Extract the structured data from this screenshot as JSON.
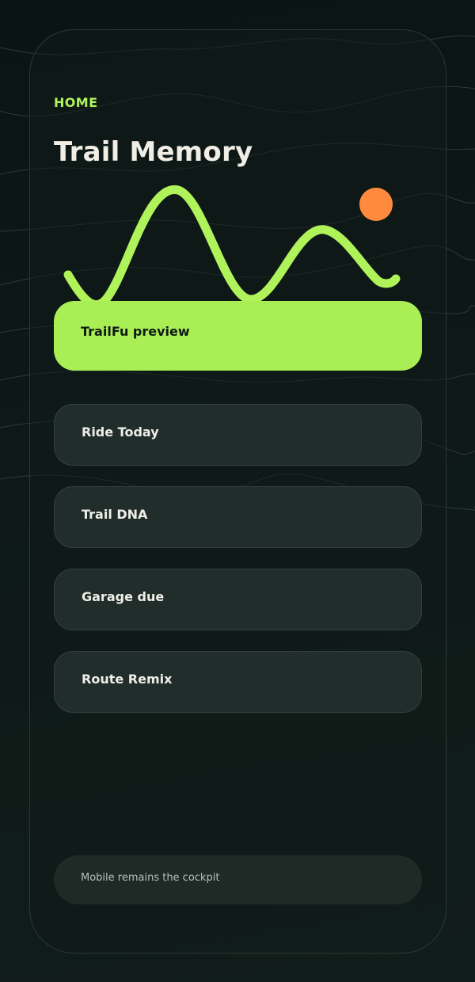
{
  "header": {
    "eyebrow": "HOME",
    "title": "Trail Memory"
  },
  "hero": {
    "trail_icon": "trail-wave-icon",
    "sun_icon": "sun-icon",
    "trail_color": "#b0f25a",
    "sun_color": "#ff8a3d"
  },
  "menu": {
    "primary": {
      "label": "TrailFu preview"
    },
    "items": [
      {
        "label": "Ride Today"
      },
      {
        "label": "Trail DNA"
      },
      {
        "label": "Garage due"
      },
      {
        "label": "Route Remix"
      }
    ]
  },
  "footer": {
    "note": "Mobile remains the cockpit"
  },
  "colors": {
    "accent": "#aaee55",
    "background": "#0e1917",
    "card": "#212d2a",
    "text": "#eeeee8"
  }
}
